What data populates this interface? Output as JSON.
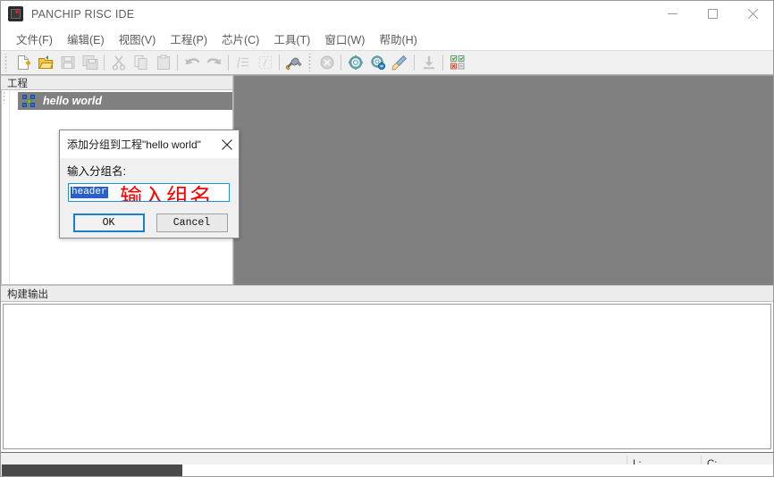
{
  "window": {
    "title": "PANCHIP RISC IDE",
    "app_icon": "chip-icon",
    "minimize_label": "Minimize",
    "maximize_label": "Maximize",
    "close_label": "Close"
  },
  "menubar": {
    "items": [
      {
        "label": "文件(F)",
        "name": "menu-file"
      },
      {
        "label": "编辑(E)",
        "name": "menu-edit"
      },
      {
        "label": "视图(V)",
        "name": "menu-view"
      },
      {
        "label": "工程(P)",
        "name": "menu-project"
      },
      {
        "label": "芯片(C)",
        "name": "menu-chip"
      },
      {
        "label": "工具(T)",
        "name": "menu-tools"
      },
      {
        "label": "窗口(W)",
        "name": "menu-window"
      },
      {
        "label": "帮助(H)",
        "name": "menu-help"
      }
    ]
  },
  "toolbar": {
    "buttons": [
      {
        "name": "new-file-icon",
        "glyph": "new",
        "enabled": true
      },
      {
        "name": "open-folder-icon",
        "glyph": "open",
        "enabled": true
      },
      {
        "name": "save-icon",
        "glyph": "save",
        "enabled": false
      },
      {
        "name": "save-all-icon",
        "glyph": "saveall",
        "enabled": false
      },
      {
        "name": "cut-icon",
        "glyph": "cut",
        "enabled": false
      },
      {
        "name": "copy-icon",
        "glyph": "copy",
        "enabled": false
      },
      {
        "name": "paste-icon",
        "glyph": "paste",
        "enabled": false
      },
      {
        "name": "undo-icon",
        "glyph": "undo",
        "enabled": false
      },
      {
        "name": "redo-icon",
        "glyph": "redo",
        "enabled": false
      },
      {
        "name": "indent-icon",
        "glyph": "indent",
        "enabled": false
      },
      {
        "name": "comment-icon",
        "glyph": "comment",
        "enabled": false
      },
      {
        "name": "build-tools-icon",
        "glyph": "tools",
        "enabled": true
      },
      {
        "name": "stop-build-icon",
        "glyph": "stop",
        "enabled": false
      },
      {
        "name": "build-icon",
        "glyph": "gear",
        "enabled": true
      },
      {
        "name": "rebuild-icon",
        "glyph": "gear2",
        "enabled": true
      },
      {
        "name": "clean-icon",
        "glyph": "broom",
        "enabled": true
      },
      {
        "name": "download-icon",
        "glyph": "download",
        "enabled": false
      },
      {
        "name": "settings-grid-icon",
        "glyph": "grid",
        "enabled": true
      }
    ]
  },
  "project_panel": {
    "header": "工程",
    "tree": [
      {
        "label": "hello world",
        "icon": "project-node-icon",
        "selected": true
      }
    ]
  },
  "output_panel": {
    "header": "构建输出",
    "content": ""
  },
  "statusbar": {
    "line_label": "L:",
    "line_value": "",
    "column_label": "C:",
    "column_value": ""
  },
  "dialog": {
    "title": "添加分组到工程\"hello world\"",
    "close_label": "×",
    "field_label": "输入分组名:",
    "input_value": "header",
    "input_placeholder": "",
    "annotation": "输入组名",
    "annotation_color": "#ff0000",
    "ok_label": "OK",
    "cancel_label": "Cancel"
  },
  "colors": {
    "accent": "#1a7fd4",
    "selection": "#2a5fc8",
    "mdi_background": "#808080",
    "toolbar_background": "#f0f0f0",
    "annotation": "#ff0000"
  }
}
